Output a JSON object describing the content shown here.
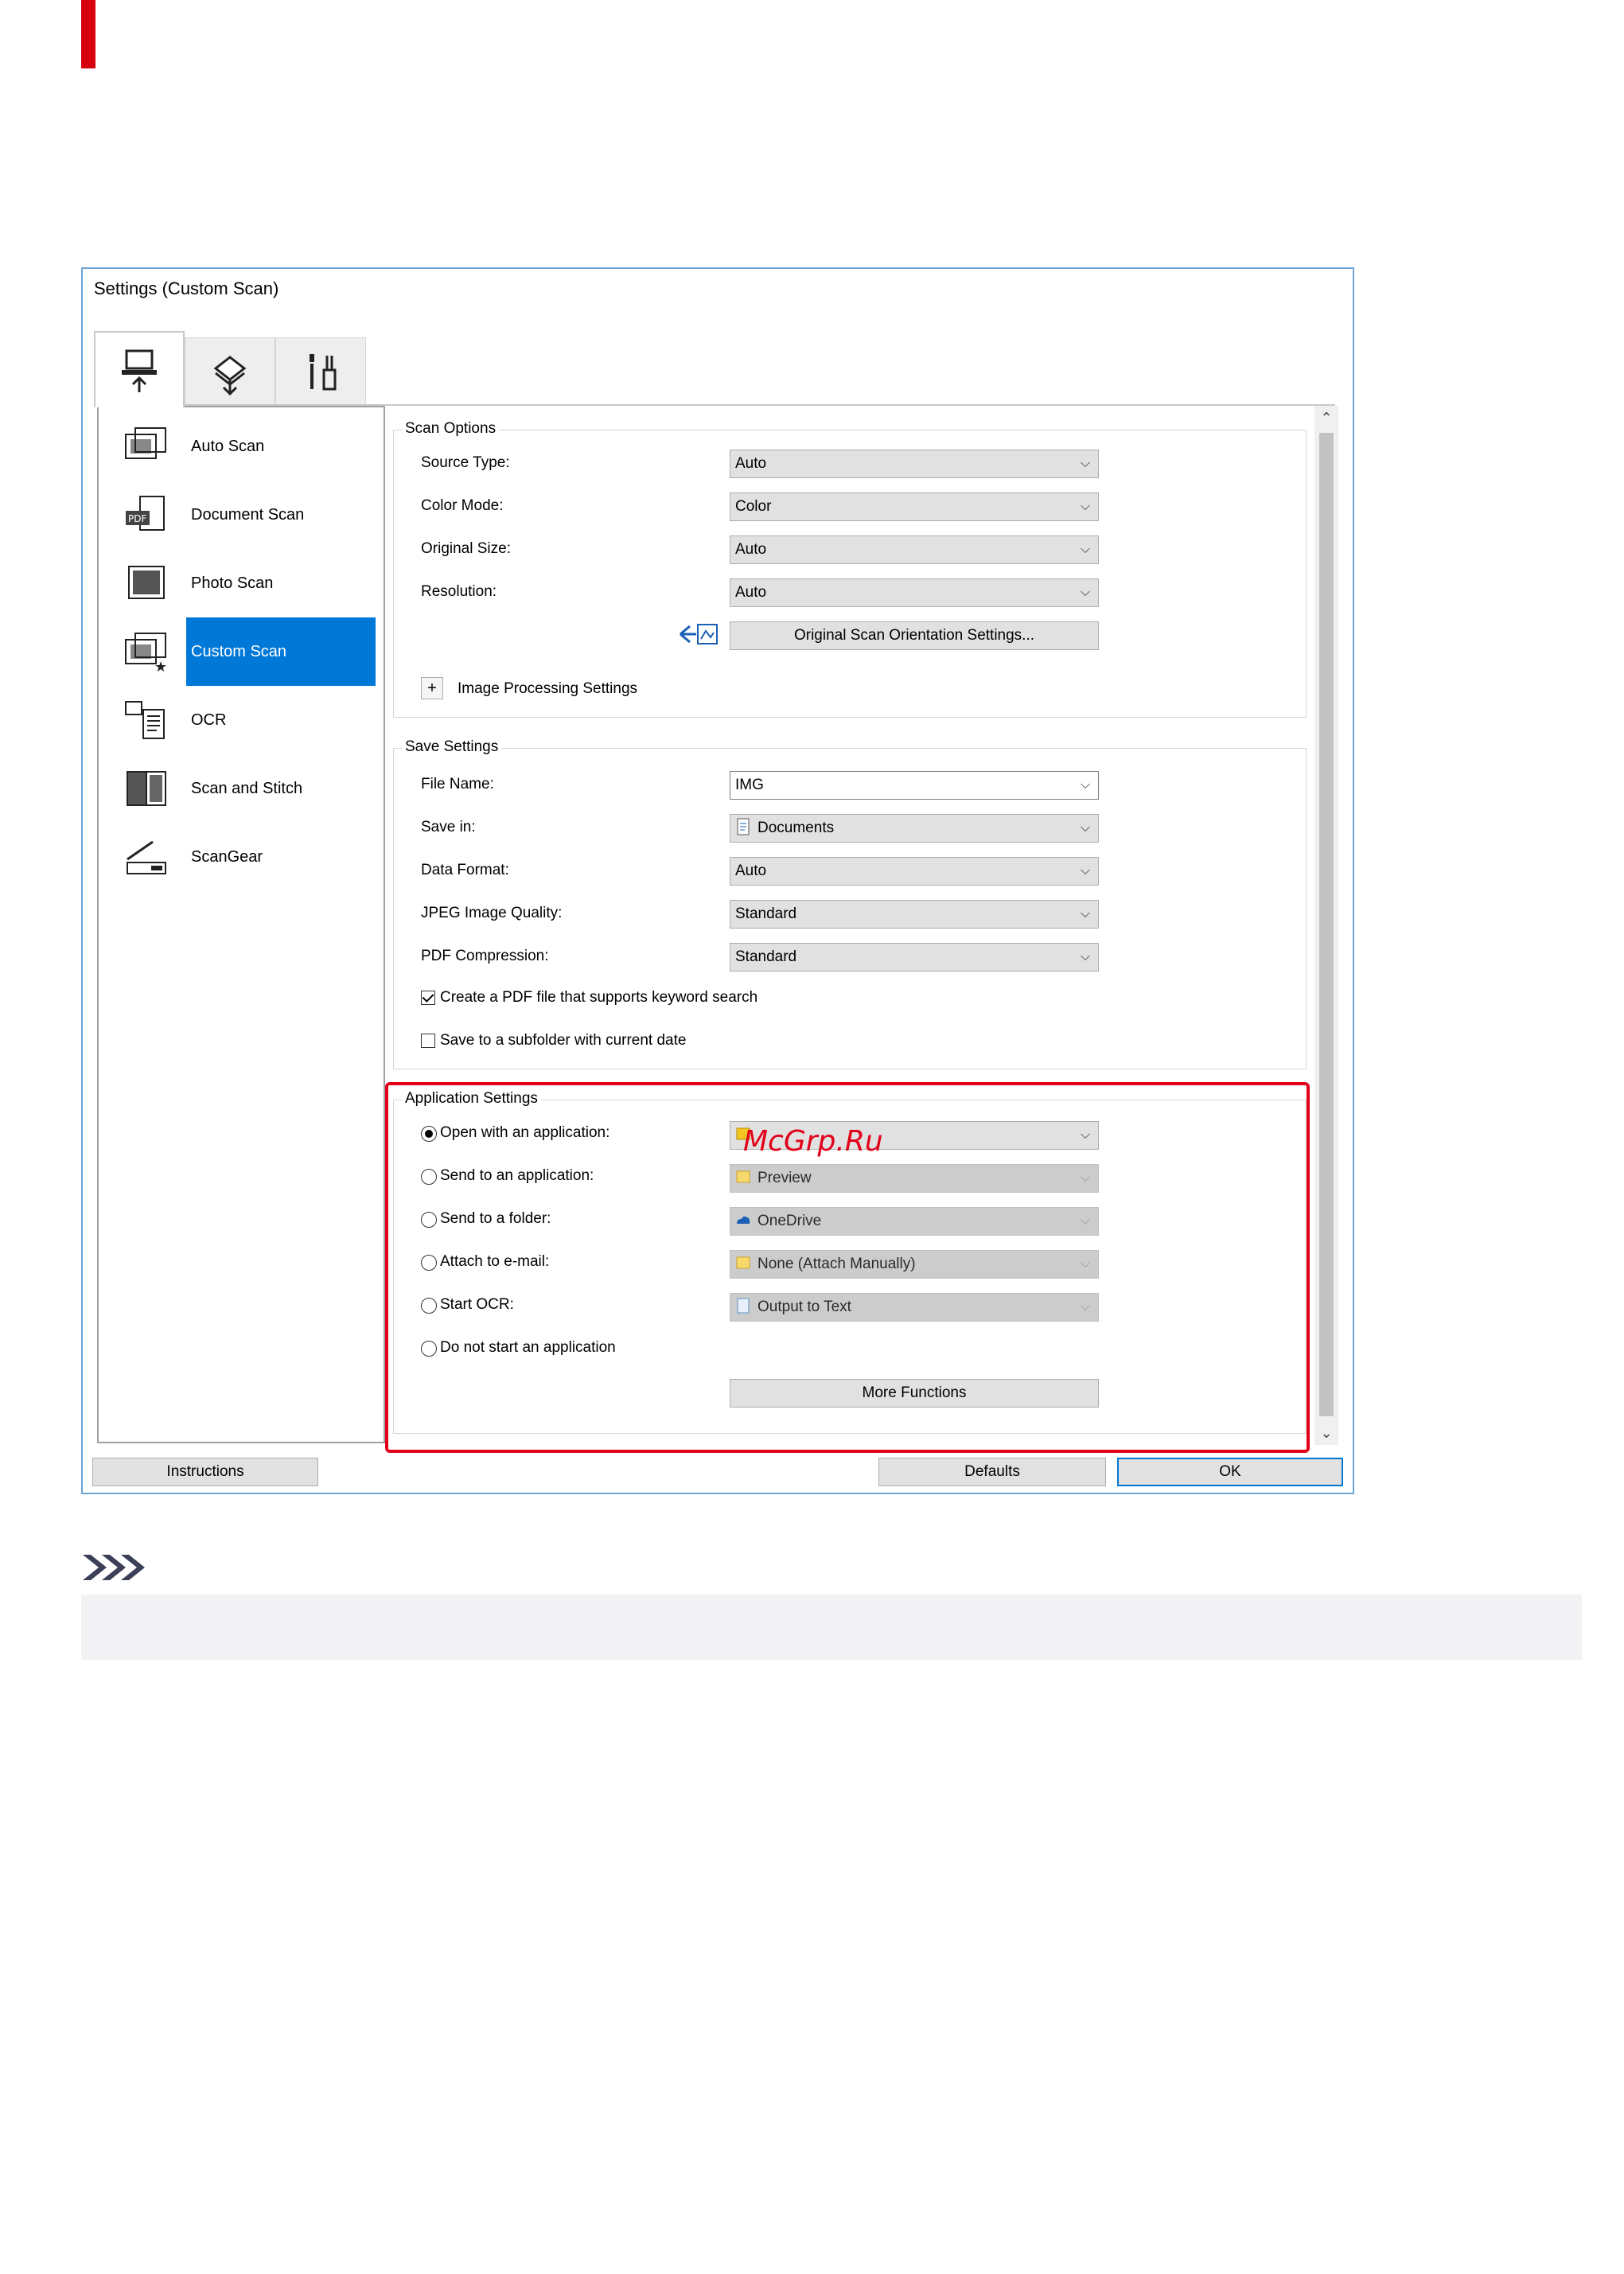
{
  "window": {
    "title": "Settings (Custom Scan)"
  },
  "tabs": [
    {
      "icon": "scan-from-computer-icon",
      "active": true
    },
    {
      "icon": "scan-from-operation-panel-icon",
      "active": false
    },
    {
      "icon": "general-settings-icon",
      "active": false
    }
  ],
  "modes": [
    {
      "label": "Auto Scan",
      "icon": "auto-scan-icon",
      "selected": false
    },
    {
      "label": "Document Scan",
      "icon": "document-scan-icon",
      "selected": false
    },
    {
      "label": "Photo Scan",
      "icon": "photo-scan-icon",
      "selected": false
    },
    {
      "label": "Custom Scan",
      "icon": "custom-scan-icon",
      "selected": true
    },
    {
      "label": "OCR",
      "icon": "ocr-icon",
      "selected": false
    },
    {
      "label": "Scan and Stitch",
      "icon": "scan-and-stitch-icon",
      "selected": false
    },
    {
      "label": "ScanGear",
      "icon": "scangear-icon",
      "selected": false
    }
  ],
  "scan_options": {
    "title": "Scan Options",
    "source_type": {
      "label": "Source Type:",
      "value": "Auto"
    },
    "color_mode": {
      "label": "Color Mode:",
      "value": "Color"
    },
    "original_size": {
      "label": "Original Size:",
      "value": "Auto"
    },
    "resolution": {
      "label": "Resolution:",
      "value": "Auto"
    },
    "orientation_button": "Original Scan Orientation Settings...",
    "image_processing": "Image Processing Settings"
  },
  "save_settings": {
    "title": "Save Settings",
    "file_name": {
      "label": "File Name:",
      "value": "IMG"
    },
    "save_in": {
      "label": "Save in:",
      "value": "Documents"
    },
    "data_format": {
      "label": "Data Format:",
      "value": "Auto"
    },
    "jpeg_quality": {
      "label": "JPEG Image Quality:",
      "value": "Standard"
    },
    "pdf_compression": {
      "label": "PDF Compression:",
      "value": "Standard"
    },
    "keyword_search": {
      "label": "Create a PDF file that supports keyword search",
      "checked": true
    },
    "subfolder": {
      "label": "Save to a subfolder with current date",
      "checked": false
    }
  },
  "application_settings": {
    "title": "Application Settings",
    "open_with": {
      "label": "Open with an application:",
      "value": "",
      "selected": true
    },
    "send_to_app": {
      "label": "Send to an application:",
      "value": "Preview"
    },
    "send_to_folder": {
      "label": "Send to a folder:",
      "value": "OneDrive"
    },
    "attach_email": {
      "label": "Attach to e-mail:",
      "value": "None (Attach Manually)"
    },
    "start_ocr": {
      "label": "Start OCR:",
      "value": "Output to Text"
    },
    "do_not_start": {
      "label": "Do not start an application"
    },
    "more_functions": "More Functions"
  },
  "footer": {
    "instructions": "Instructions",
    "defaults": "Defaults",
    "ok": "OK"
  },
  "watermark": "McGrp.Ru",
  "colors": {
    "accent": "#0078d7",
    "highlight": "#e2001a",
    "brand_bar": "#d7000f"
  }
}
